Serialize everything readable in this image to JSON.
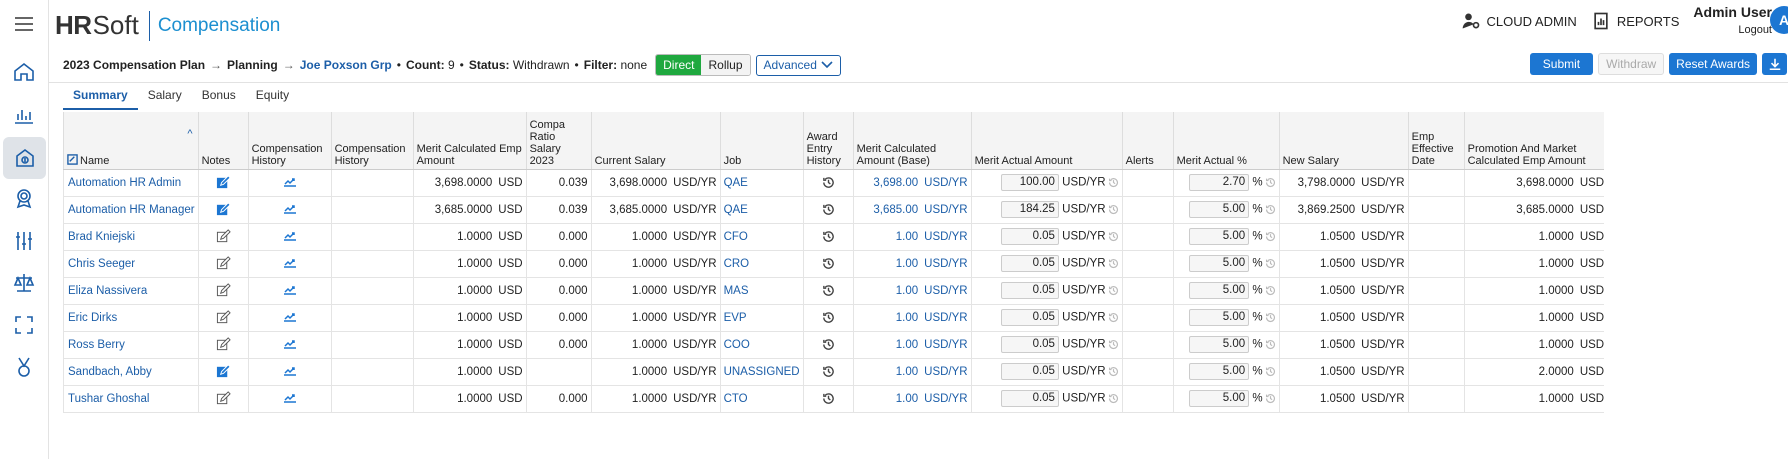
{
  "app": {
    "brand_bold": "HR",
    "brand_rest": "Soft",
    "product": "Compensation"
  },
  "header": {
    "cloud_admin": "CLOUD ADMIN",
    "reports": "REPORTS",
    "user_name": "Admin User",
    "logout": "Logout",
    "avatar_initial": "A"
  },
  "rail": {
    "icons": [
      "menu-icon",
      "home-icon",
      "analytics-icon",
      "compensation-icon",
      "awards-icon",
      "settings-sliders-icon",
      "balance-icon",
      "expand-icon",
      "medal-icon"
    ]
  },
  "breadcrumb": {
    "plan": "2023 Compensation Plan",
    "arrow": "→",
    "step": "Planning",
    "group": "Joe Poxson Grp",
    "count_label": "Count:",
    "count_value": "9",
    "status_label": "Status:",
    "status_value": "Withdrawn",
    "filter_label": "Filter:",
    "filter_value": "none",
    "direct": "Direct",
    "rollup": "Rollup",
    "advanced": "Advanced"
  },
  "actions": {
    "submit": "Submit",
    "withdraw": "Withdraw",
    "reset": "Reset Awards"
  },
  "tabs": [
    "Summary",
    "Salary",
    "Bonus",
    "Equity"
  ],
  "columns": [
    "Name",
    "Notes",
    "Compensation History",
    "Compensation History",
    "Merit Calculated Emp Amount",
    "Compa Ratio Salary 2023",
    "Current Salary",
    "Job",
    "Award Entry History",
    "Merit Calculated Amount (Base)",
    "Merit Actual Amount",
    "Alerts",
    "Merit Actual %",
    "New Salary",
    "Emp Effective Date",
    "Promotion And Market Calculated Emp Amount"
  ],
  "rows": [
    {
      "name": "Automation HR Admin",
      "note_active": true,
      "merit_calc": "3,698.0000",
      "merit_cur": "USD",
      "compa": "0.039",
      "cur_salary": "3,698.0000",
      "cur_unit": "USD/YR",
      "job": "QAE",
      "merit_base": "3,698.00",
      "merit_base_unit": "USD/YR",
      "merit_actual": "100.00",
      "merit_actual_unit": "USD/YR",
      "pct": "2.70",
      "pct_unit": "%",
      "new_salary": "3,798.0000",
      "new_unit": "USD/YR",
      "promo": "3,698.0000",
      "promo_unit": "USD"
    },
    {
      "name": "Automation HR Manager",
      "note_active": true,
      "merit_calc": "3,685.0000",
      "merit_cur": "USD",
      "compa": "0.039",
      "cur_salary": "3,685.0000",
      "cur_unit": "USD/YR",
      "job": "QAE",
      "merit_base": "3,685.00",
      "merit_base_unit": "USD/YR",
      "merit_actual": "184.25",
      "merit_actual_unit": "USD/YR",
      "pct": "5.00",
      "pct_unit": "%",
      "new_salary": "3,869.2500",
      "new_unit": "USD/YR",
      "promo": "3,685.0000",
      "promo_unit": "USD"
    },
    {
      "name": "Brad Kniejski",
      "note_active": false,
      "merit_calc": "1.0000",
      "merit_cur": "USD",
      "compa": "0.000",
      "cur_salary": "1.0000",
      "cur_unit": "USD/YR",
      "job": "CFO",
      "merit_base": "1.00",
      "merit_base_unit": "USD/YR",
      "merit_actual": "0.05",
      "merit_actual_unit": "USD/YR",
      "pct": "5.00",
      "pct_unit": "%",
      "new_salary": "1.0500",
      "new_unit": "USD/YR",
      "promo": "1.0000",
      "promo_unit": "USD"
    },
    {
      "name": "Chris Seeger",
      "note_active": false,
      "merit_calc": "1.0000",
      "merit_cur": "USD",
      "compa": "0.000",
      "cur_salary": "1.0000",
      "cur_unit": "USD/YR",
      "job": "CRO",
      "merit_base": "1.00",
      "merit_base_unit": "USD/YR",
      "merit_actual": "0.05",
      "merit_actual_unit": "USD/YR",
      "pct": "5.00",
      "pct_unit": "%",
      "new_salary": "1.0500",
      "new_unit": "USD/YR",
      "promo": "1.0000",
      "promo_unit": "USD"
    },
    {
      "name": "Eliza Nassivera",
      "note_active": false,
      "merit_calc": "1.0000",
      "merit_cur": "USD",
      "compa": "0.000",
      "cur_salary": "1.0000",
      "cur_unit": "USD/YR",
      "job": "MAS",
      "merit_base": "1.00",
      "merit_base_unit": "USD/YR",
      "merit_actual": "0.05",
      "merit_actual_unit": "USD/YR",
      "pct": "5.00",
      "pct_unit": "%",
      "new_salary": "1.0500",
      "new_unit": "USD/YR",
      "promo": "1.0000",
      "promo_unit": "USD"
    },
    {
      "name": "Eric Dirks",
      "note_active": false,
      "merit_calc": "1.0000",
      "merit_cur": "USD",
      "compa": "0.000",
      "cur_salary": "1.0000",
      "cur_unit": "USD/YR",
      "job": "EVP",
      "merit_base": "1.00",
      "merit_base_unit": "USD/YR",
      "merit_actual": "0.05",
      "merit_actual_unit": "USD/YR",
      "pct": "5.00",
      "pct_unit": "%",
      "new_salary": "1.0500",
      "new_unit": "USD/YR",
      "promo": "1.0000",
      "promo_unit": "USD"
    },
    {
      "name": "Ross Berry",
      "note_active": false,
      "merit_calc": "1.0000",
      "merit_cur": "USD",
      "compa": "0.000",
      "cur_salary": "1.0000",
      "cur_unit": "USD/YR",
      "job": "COO",
      "merit_base": "1.00",
      "merit_base_unit": "USD/YR",
      "merit_actual": "0.05",
      "merit_actual_unit": "USD/YR",
      "pct": "5.00",
      "pct_unit": "%",
      "new_salary": "1.0500",
      "new_unit": "USD/YR",
      "promo": "1.0000",
      "promo_unit": "USD"
    },
    {
      "name": "Sandbach, Abby",
      "note_active": true,
      "merit_calc": "1.0000",
      "merit_cur": "USD",
      "compa": "",
      "cur_salary": "1.0000",
      "cur_unit": "USD/YR",
      "job": "UNASSIGNED",
      "merit_base": "1.00",
      "merit_base_unit": "USD/YR",
      "merit_actual": "0.05",
      "merit_actual_unit": "USD/YR",
      "pct": "5.00",
      "pct_unit": "%",
      "new_salary": "1.0500",
      "new_unit": "USD/YR",
      "promo": "2.0000",
      "promo_unit": "USD"
    },
    {
      "name": "Tushar Ghoshal",
      "note_active": false,
      "merit_calc": "1.0000",
      "merit_cur": "USD",
      "compa": "0.000",
      "cur_salary": "1.0000",
      "cur_unit": "USD/YR",
      "job": "CTO",
      "merit_base": "1.00",
      "merit_base_unit": "USD/YR",
      "merit_actual": "0.05",
      "merit_actual_unit": "USD/YR",
      "pct": "5.00",
      "pct_unit": "%",
      "new_salary": "1.0500",
      "new_unit": "USD/YR",
      "promo": "1.0000",
      "promo_unit": "USD"
    }
  ],
  "colors": {
    "accent": "#1c76d2",
    "link": "#1c5ea8",
    "direct_on": "#1fa83f"
  }
}
